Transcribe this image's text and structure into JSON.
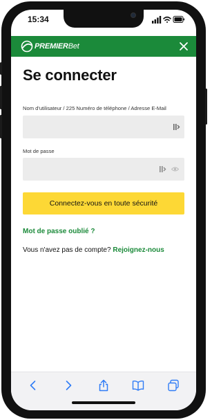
{
  "status_bar": {
    "time": "15:34"
  },
  "header": {
    "brand_main": "PREMIER",
    "brand_suffix": "Bet"
  },
  "login": {
    "title": "Se connecter",
    "username_label": "Nom d'utilisateur / 225 Numéro de téléphone / Adresse E-Mail",
    "username_value": "",
    "password_label": "Mot de passe",
    "password_value": "",
    "submit_label": "Connectez-vous en toute sécurité",
    "forgot_label": "Mot de passe oublié ?",
    "signup_prompt": "Vous n'avez pas de compte?",
    "signup_link": "Rejoignez-nous"
  },
  "colors": {
    "brand_green": "#1b8a3a",
    "button_yellow": "#fdd835",
    "field_bg": "#ececec"
  },
  "icons": {
    "header": [
      "premierbet-logo-icon",
      "close-icon"
    ],
    "status": [
      "signal-icon",
      "wifi-icon",
      "battery-icon"
    ],
    "fields": [
      "password-manager-icon",
      "eye-icon"
    ],
    "browser_toolbar": [
      "back-icon",
      "forward-icon",
      "share-icon",
      "bookmarks-icon",
      "tabs-icon"
    ]
  }
}
